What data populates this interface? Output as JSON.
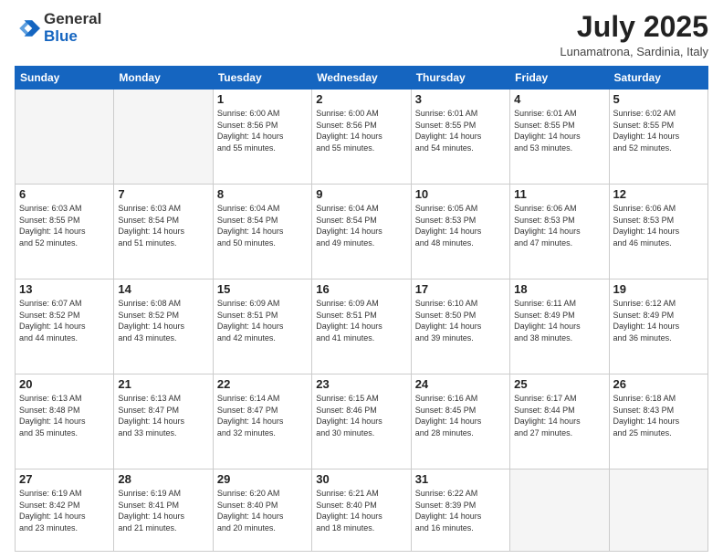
{
  "logo": {
    "line1": "General",
    "line2": "Blue"
  },
  "header": {
    "month": "July 2025",
    "location": "Lunamatrona, Sardinia, Italy"
  },
  "weekdays": [
    "Sunday",
    "Monday",
    "Tuesday",
    "Wednesday",
    "Thursday",
    "Friday",
    "Saturday"
  ],
  "weeks": [
    [
      {
        "day": "",
        "text": ""
      },
      {
        "day": "",
        "text": ""
      },
      {
        "day": "1",
        "text": "Sunrise: 6:00 AM\nSunset: 8:56 PM\nDaylight: 14 hours\nand 55 minutes."
      },
      {
        "day": "2",
        "text": "Sunrise: 6:00 AM\nSunset: 8:56 PM\nDaylight: 14 hours\nand 55 minutes."
      },
      {
        "day": "3",
        "text": "Sunrise: 6:01 AM\nSunset: 8:55 PM\nDaylight: 14 hours\nand 54 minutes."
      },
      {
        "day": "4",
        "text": "Sunrise: 6:01 AM\nSunset: 8:55 PM\nDaylight: 14 hours\nand 53 minutes."
      },
      {
        "day": "5",
        "text": "Sunrise: 6:02 AM\nSunset: 8:55 PM\nDaylight: 14 hours\nand 52 minutes."
      }
    ],
    [
      {
        "day": "6",
        "text": "Sunrise: 6:03 AM\nSunset: 8:55 PM\nDaylight: 14 hours\nand 52 minutes."
      },
      {
        "day": "7",
        "text": "Sunrise: 6:03 AM\nSunset: 8:54 PM\nDaylight: 14 hours\nand 51 minutes."
      },
      {
        "day": "8",
        "text": "Sunrise: 6:04 AM\nSunset: 8:54 PM\nDaylight: 14 hours\nand 50 minutes."
      },
      {
        "day": "9",
        "text": "Sunrise: 6:04 AM\nSunset: 8:54 PM\nDaylight: 14 hours\nand 49 minutes."
      },
      {
        "day": "10",
        "text": "Sunrise: 6:05 AM\nSunset: 8:53 PM\nDaylight: 14 hours\nand 48 minutes."
      },
      {
        "day": "11",
        "text": "Sunrise: 6:06 AM\nSunset: 8:53 PM\nDaylight: 14 hours\nand 47 minutes."
      },
      {
        "day": "12",
        "text": "Sunrise: 6:06 AM\nSunset: 8:53 PM\nDaylight: 14 hours\nand 46 minutes."
      }
    ],
    [
      {
        "day": "13",
        "text": "Sunrise: 6:07 AM\nSunset: 8:52 PM\nDaylight: 14 hours\nand 44 minutes."
      },
      {
        "day": "14",
        "text": "Sunrise: 6:08 AM\nSunset: 8:52 PM\nDaylight: 14 hours\nand 43 minutes."
      },
      {
        "day": "15",
        "text": "Sunrise: 6:09 AM\nSunset: 8:51 PM\nDaylight: 14 hours\nand 42 minutes."
      },
      {
        "day": "16",
        "text": "Sunrise: 6:09 AM\nSunset: 8:51 PM\nDaylight: 14 hours\nand 41 minutes."
      },
      {
        "day": "17",
        "text": "Sunrise: 6:10 AM\nSunset: 8:50 PM\nDaylight: 14 hours\nand 39 minutes."
      },
      {
        "day": "18",
        "text": "Sunrise: 6:11 AM\nSunset: 8:49 PM\nDaylight: 14 hours\nand 38 minutes."
      },
      {
        "day": "19",
        "text": "Sunrise: 6:12 AM\nSunset: 8:49 PM\nDaylight: 14 hours\nand 36 minutes."
      }
    ],
    [
      {
        "day": "20",
        "text": "Sunrise: 6:13 AM\nSunset: 8:48 PM\nDaylight: 14 hours\nand 35 minutes."
      },
      {
        "day": "21",
        "text": "Sunrise: 6:13 AM\nSunset: 8:47 PM\nDaylight: 14 hours\nand 33 minutes."
      },
      {
        "day": "22",
        "text": "Sunrise: 6:14 AM\nSunset: 8:47 PM\nDaylight: 14 hours\nand 32 minutes."
      },
      {
        "day": "23",
        "text": "Sunrise: 6:15 AM\nSunset: 8:46 PM\nDaylight: 14 hours\nand 30 minutes."
      },
      {
        "day": "24",
        "text": "Sunrise: 6:16 AM\nSunset: 8:45 PM\nDaylight: 14 hours\nand 28 minutes."
      },
      {
        "day": "25",
        "text": "Sunrise: 6:17 AM\nSunset: 8:44 PM\nDaylight: 14 hours\nand 27 minutes."
      },
      {
        "day": "26",
        "text": "Sunrise: 6:18 AM\nSunset: 8:43 PM\nDaylight: 14 hours\nand 25 minutes."
      }
    ],
    [
      {
        "day": "27",
        "text": "Sunrise: 6:19 AM\nSunset: 8:42 PM\nDaylight: 14 hours\nand 23 minutes."
      },
      {
        "day": "28",
        "text": "Sunrise: 6:19 AM\nSunset: 8:41 PM\nDaylight: 14 hours\nand 21 minutes."
      },
      {
        "day": "29",
        "text": "Sunrise: 6:20 AM\nSunset: 8:40 PM\nDaylight: 14 hours\nand 20 minutes."
      },
      {
        "day": "30",
        "text": "Sunrise: 6:21 AM\nSunset: 8:40 PM\nDaylight: 14 hours\nand 18 minutes."
      },
      {
        "day": "31",
        "text": "Sunrise: 6:22 AM\nSunset: 8:39 PM\nDaylight: 14 hours\nand 16 minutes."
      },
      {
        "day": "",
        "text": ""
      },
      {
        "day": "",
        "text": ""
      }
    ]
  ]
}
